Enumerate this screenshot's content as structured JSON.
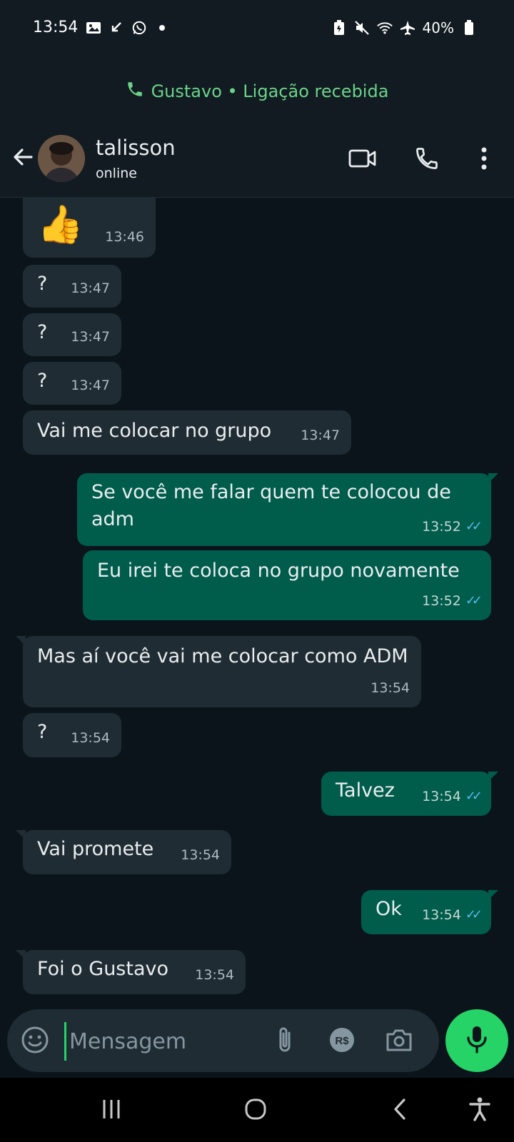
{
  "status_bar": {
    "time": "13:54",
    "battery": "40%"
  },
  "call_banner": {
    "text": "Gustavo • Ligação recebida",
    "color": "#6cd289"
  },
  "header": {
    "contact_name": "talisson",
    "contact_status": "online"
  },
  "messages": [
    {
      "dir": "in",
      "text": "👍",
      "time": "13:46"
    },
    {
      "dir": "in",
      "text": "?",
      "time": "13:47"
    },
    {
      "dir": "in",
      "text": "?",
      "time": "13:47"
    },
    {
      "dir": "in",
      "text": "?",
      "time": "13:47"
    },
    {
      "dir": "in",
      "text": "Vai me colocar no grupo",
      "time": "13:47"
    },
    {
      "dir": "out",
      "text": "Se você me falar quem te colocou de adm",
      "time": "13:52",
      "read": true
    },
    {
      "dir": "out",
      "text": "Eu irei te coloca no grupo novamente",
      "time": "13:52",
      "read": true
    },
    {
      "dir": "in",
      "text": "Mas aí você vai me colocar como ADM",
      "time": "13:54"
    },
    {
      "dir": "in",
      "text": "?",
      "time": "13:54"
    },
    {
      "dir": "out",
      "text": "Talvez",
      "time": "13:54",
      "read": true
    },
    {
      "dir": "in",
      "text": "Vai promete",
      "time": "13:54"
    },
    {
      "dir": "out",
      "text": "Ok",
      "time": "13:54",
      "read": true
    },
    {
      "dir": "in",
      "text": "Foi o Gustavo",
      "time": "13:54"
    }
  ],
  "input": {
    "placeholder": "Mensagem"
  },
  "colors": {
    "accent": "#25d366",
    "incoming_bubble": "#202c33",
    "outgoing_bubble": "#005c4b",
    "read_ticks": "#53bdeb",
    "background": "#0b141a"
  }
}
